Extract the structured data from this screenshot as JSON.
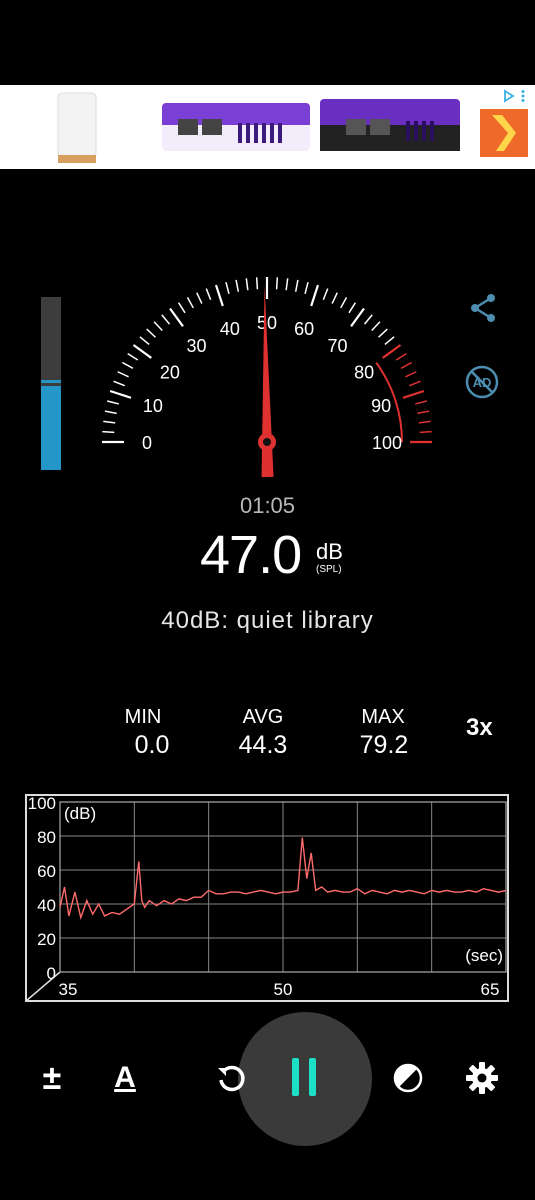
{
  "ad": {
    "tiles": [
      "white-router-product",
      "purple-gateway-product",
      "black-purple-gateway-product",
      "partial-brand-logo"
    ]
  },
  "meter": {
    "level_fraction": 0.47,
    "gauge_ticks": [
      "0",
      "10",
      "20",
      "30",
      "40",
      "50",
      "60",
      "70",
      "80",
      "90",
      "100"
    ],
    "needle_value": 49.5,
    "danger_from": 80,
    "timer": "01:05",
    "value": "47.0",
    "unit": "dB",
    "unit_sub": "(SPL)",
    "reference": "40dB: quiet library"
  },
  "stats": {
    "min_label": "MIN",
    "min_value": "0.0",
    "avg_label": "AVG",
    "avg_value": "44.3",
    "max_label": "MAX",
    "max_value": "79.2",
    "multiplier": "3x"
  },
  "chart_data": {
    "type": "line",
    "ylabel": "(dB)",
    "xlabel": "(sec)",
    "y_ticks": [
      "100",
      "80",
      "60",
      "40",
      "20",
      "0"
    ],
    "x_ticks": [
      "35",
      "50",
      "65"
    ],
    "xlim": [
      35,
      65
    ],
    "ylim": [
      0,
      100
    ],
    "grid": true,
    "series": [
      {
        "color": "#ff6b6b",
        "x": [
          35,
          35.3,
          35.6,
          36,
          36.4,
          36.8,
          37.2,
          37.6,
          38,
          38.5,
          39,
          39.5,
          40,
          40.3,
          40.5,
          40.7,
          41,
          41.5,
          42,
          42.5,
          43,
          43.5,
          44,
          44.5,
          45,
          45.5,
          46,
          46.5,
          47,
          47.5,
          48,
          48.5,
          49,
          49.5,
          50,
          50.5,
          51,
          51.3,
          51.6,
          51.9,
          52.2,
          52.6,
          53,
          53.5,
          54,
          54.5,
          55,
          55.5,
          56,
          56.5,
          57,
          57.5,
          58,
          58.5,
          59,
          59.5,
          60,
          60.5,
          61,
          61.5,
          62,
          62.5,
          63,
          63.5,
          64,
          64.5,
          65
        ],
        "y": [
          38,
          50,
          33,
          47,
          32,
          42,
          34,
          40,
          33,
          35,
          34,
          37,
          40,
          65,
          42,
          38,
          42,
          39,
          42,
          40,
          43,
          42,
          44,
          44,
          48,
          46,
          46,
          47,
          47,
          46,
          47,
          48,
          47,
          46,
          47,
          47,
          48,
          79,
          55,
          70,
          48,
          50,
          47,
          48,
          47,
          47,
          49,
          46,
          48,
          47,
          46,
          48,
          47,
          48,
          47,
          46,
          48,
          47,
          48,
          47,
          47,
          48,
          47,
          49,
          48,
          47,
          48
        ]
      }
    ]
  },
  "toolbar": {
    "calibrate": "±",
    "weighting": "A",
    "icons": [
      "plus-minus-icon",
      "a-weighting-icon",
      "reset-icon",
      "pause-icon",
      "theme-icon",
      "settings-icon"
    ]
  }
}
